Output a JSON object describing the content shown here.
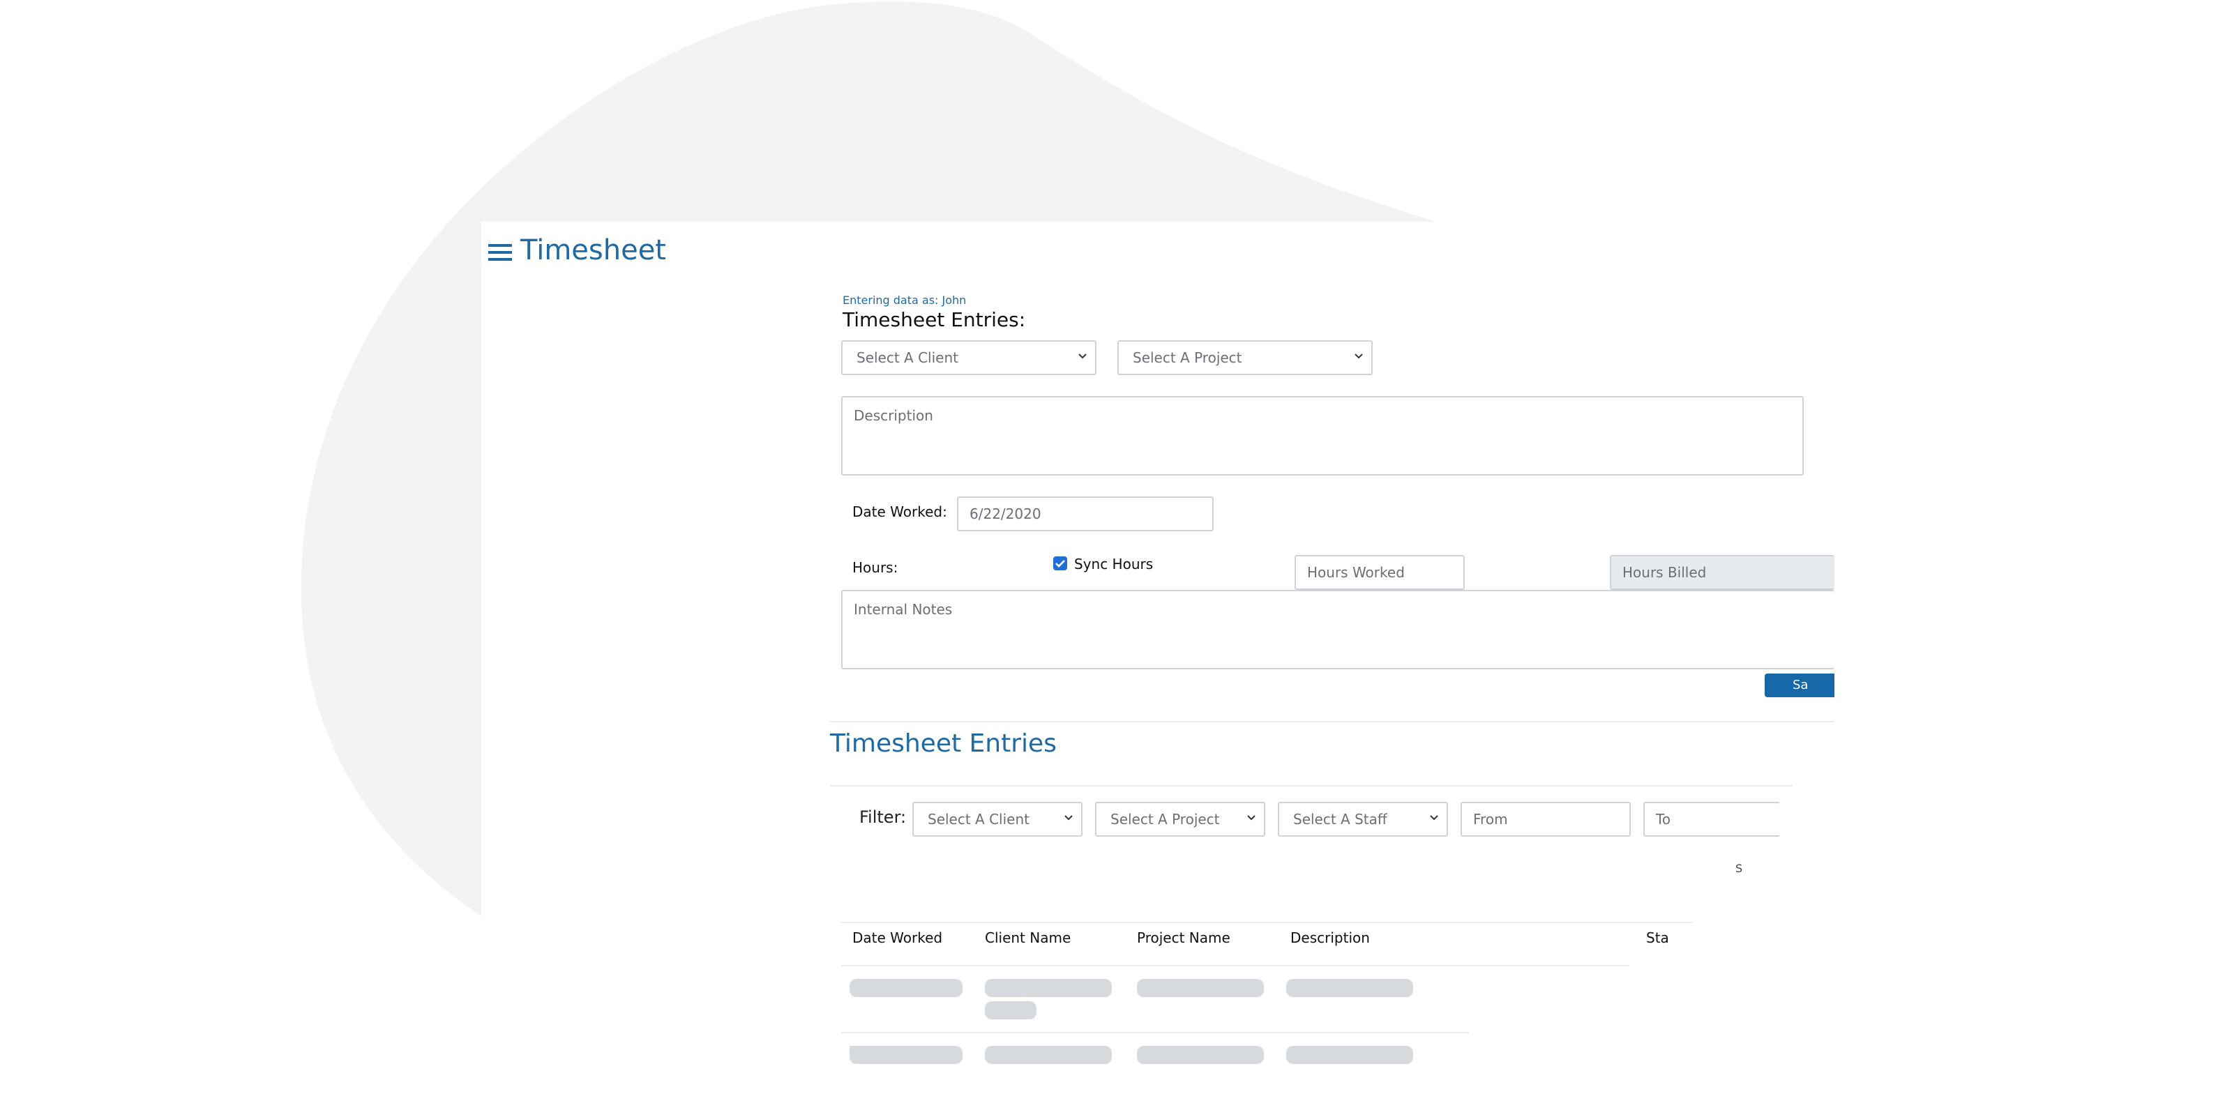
{
  "app": {
    "title": "Timesheet"
  },
  "form": {
    "entering_as": "Entering data as: John",
    "heading": "Timesheet Entries:",
    "client_select": "Select A Client",
    "project_select": "Select A Project",
    "description_placeholder": "Description",
    "date_label": "Date Worked:",
    "date_value": "6/22/2020",
    "hours_label": "Hours:",
    "sync_label": "Sync Hours",
    "sync_checked": true,
    "hours_worked_placeholder": "Hours Worked",
    "hours_billed_placeholder": "Hours Billed",
    "notes_placeholder": "Internal Notes",
    "save_label": "Sa"
  },
  "list": {
    "heading": "Timesheet Entries",
    "filter_label": "Filter:",
    "filter_client": "Select A Client",
    "filter_project": "Select A Project",
    "filter_staff": "Select A Staff",
    "from_placeholder": "From",
    "to_placeholder": "To",
    "stray_text": "S",
    "columns": [
      "Date Worked",
      "Client Name",
      "Project Name",
      "Description",
      "Sta"
    ]
  },
  "colors": {
    "accent": "#1f6aa5",
    "button": "#1768a8",
    "skeleton": "#d7dadd",
    "background_blob": "#f2f3f3"
  }
}
